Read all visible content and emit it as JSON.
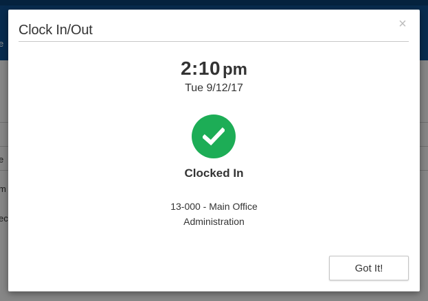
{
  "modal": {
    "title": "Clock In/Out",
    "close_label": "×",
    "time": "2:10",
    "ampm": "pm",
    "date": "Tue 9/12/17",
    "status": "Clocked In",
    "status_icon": "check-icon",
    "status_color": "#1dad56",
    "location_code": "13-000 - Main Office",
    "location_department": "Administration",
    "confirm_button": "Got It!"
  },
  "background": {
    "topbar_color": "#0f4f8f",
    "snippet_1": "e",
    "snippet_2": "e",
    "snippet_3": "m",
    "snippet_4": "ec"
  }
}
